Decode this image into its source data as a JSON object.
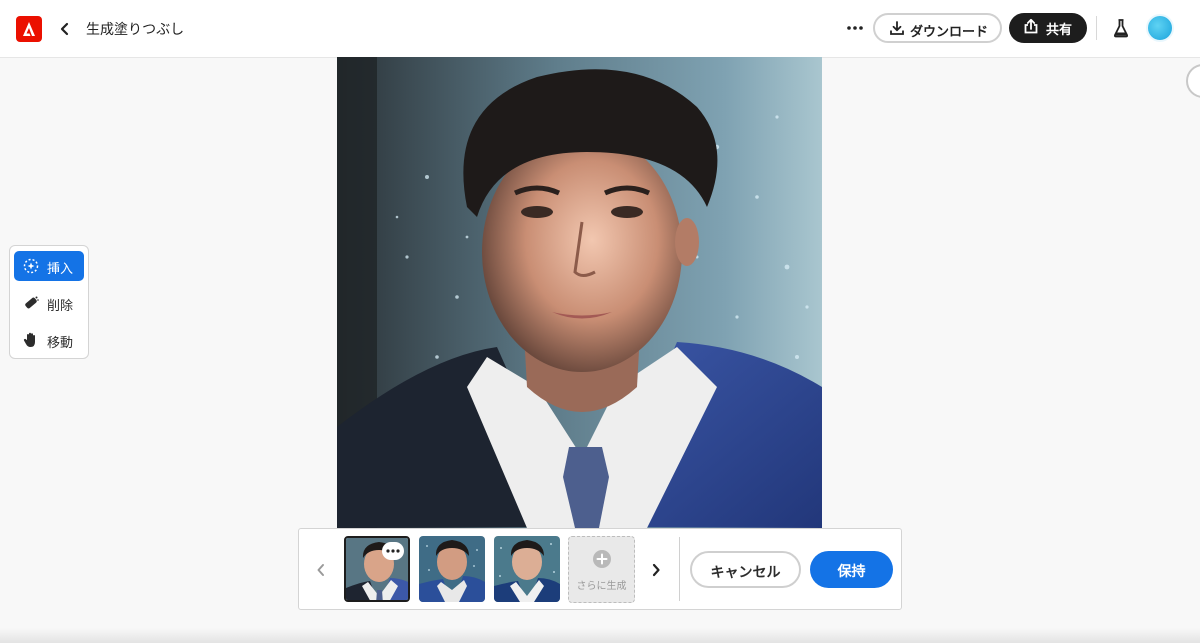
{
  "header": {
    "title": "生成塗りつぶし",
    "download_label": "ダウンロード",
    "share_label": "共有",
    "brand_color": "#eb1000"
  },
  "tools": {
    "items": [
      {
        "label": "挿入",
        "icon": "insert-sparkle-icon",
        "active": true
      },
      {
        "label": "削除",
        "icon": "eraser-icon",
        "active": false
      },
      {
        "label": "移動",
        "icon": "hand-icon",
        "active": false
      }
    ],
    "accent": "#1473e6"
  },
  "variations": {
    "generate_more_label": "さらに生成",
    "selected_index": 0,
    "count": 3
  },
  "actions": {
    "cancel_label": "キャンセル",
    "keep_label": "保持"
  },
  "icons": {
    "back": "chevron-left-icon",
    "more": "more-horizontal-icon",
    "download": "download-icon",
    "share": "share-icon",
    "labs": "flask-icon",
    "avatar": "user-avatar",
    "prev": "chevron-left-icon",
    "next": "chevron-right-icon"
  }
}
